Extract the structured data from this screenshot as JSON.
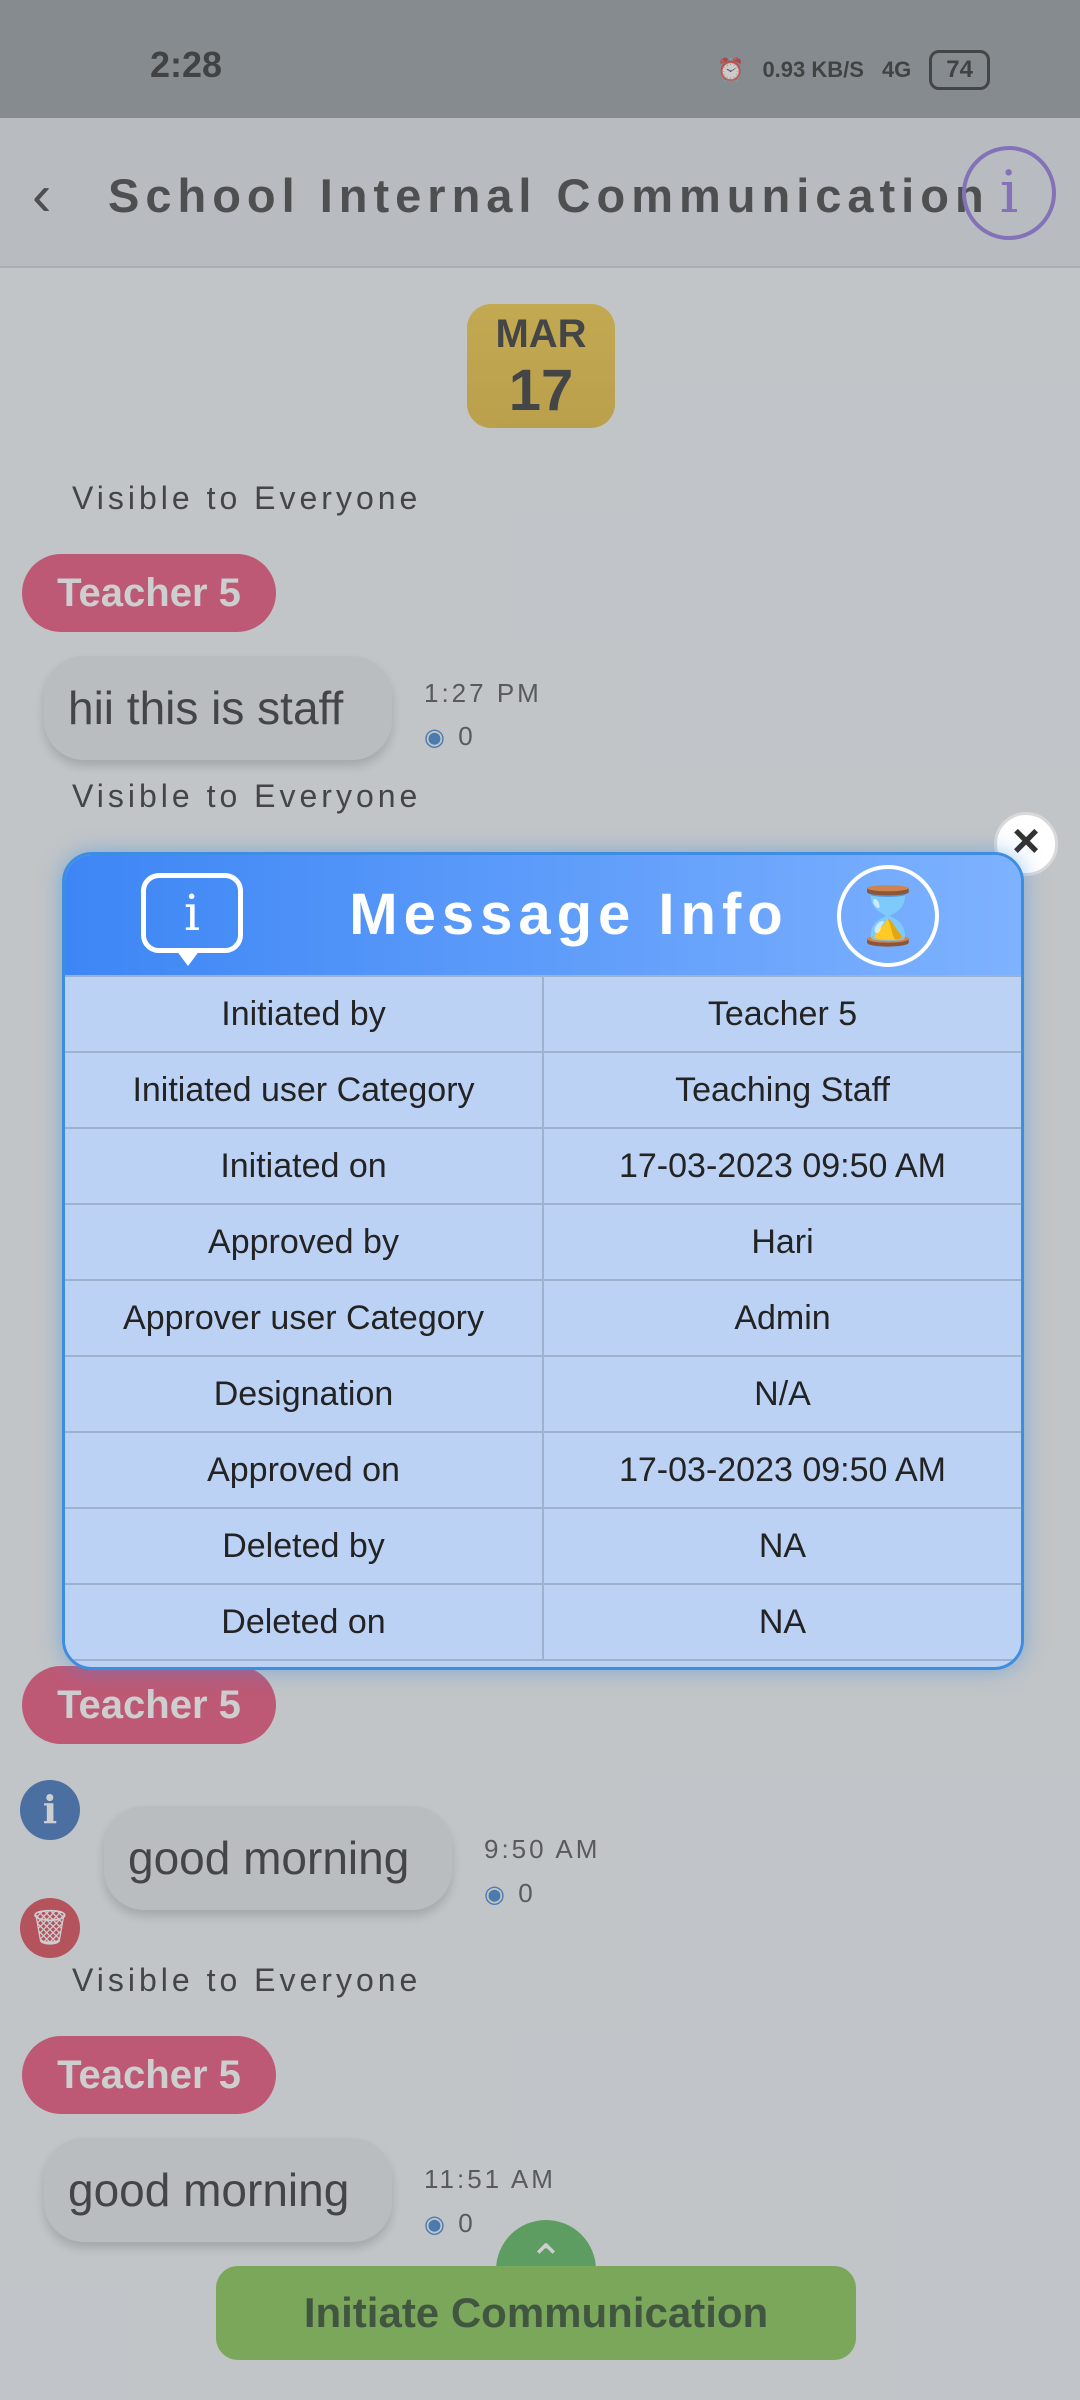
{
  "status": {
    "time": "2:28",
    "network_speed": "0.93 KB/S",
    "signal": "4G",
    "battery": "74"
  },
  "header": {
    "title": "School Internal Communication"
  },
  "chat": {
    "date": {
      "month": "MAR",
      "day": "17"
    },
    "items": [
      {
        "visibility": "Visible to Everyone"
      },
      {
        "sender": "Teacher 5",
        "text": "hii this is staff",
        "time": "1:27 PM",
        "views": "0",
        "visibility": "Visible to Everyone"
      },
      {
        "sender": "Teacher 5",
        "text": "good morning",
        "time": "9:50 AM",
        "views": "0",
        "visibility": "Visible to Everyone"
      },
      {
        "sender": "Teacher 5",
        "text": "good morning",
        "time": "11:51 AM",
        "views": "0"
      }
    ],
    "action_button": "Initiate Communication"
  },
  "modal": {
    "title": "Message Info",
    "rows": [
      {
        "label": "Initiated by",
        "value": "Teacher 5"
      },
      {
        "label": "Initiated user Category",
        "value": "Teaching Staff"
      },
      {
        "label": "Initiated on",
        "value": "17-03-2023 09:50 AM"
      },
      {
        "label": "Approved by",
        "value": "Hari"
      },
      {
        "label": "Approver user Category",
        "value": "Admin"
      },
      {
        "label": "Designation",
        "value": "N/A"
      },
      {
        "label": "Approved on",
        "value": "17-03-2023 09:50 AM"
      },
      {
        "label": "Deleted by",
        "value": "NA"
      },
      {
        "label": "Deleted on",
        "value": "NA"
      }
    ]
  },
  "colors": {
    "accent_blue": "#3d86f5",
    "teacher_tag": "#e9436d",
    "action_green": "#7cc043"
  }
}
